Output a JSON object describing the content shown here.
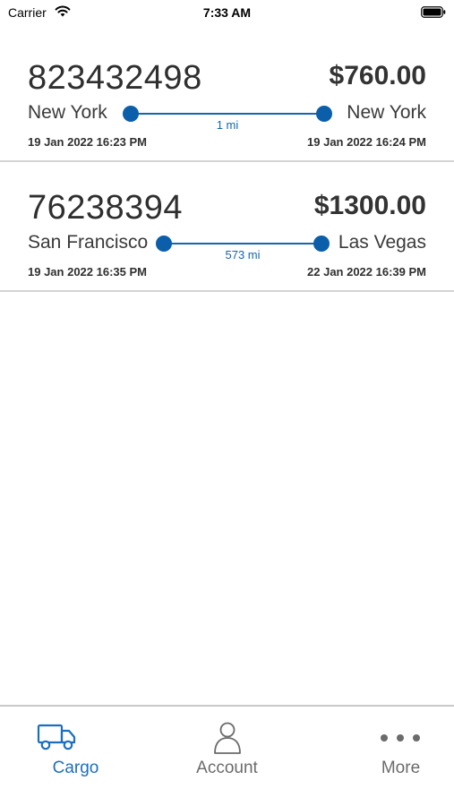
{
  "status_bar": {
    "carrier": "Carrier",
    "time": "7:33 AM"
  },
  "shipments": [
    {
      "id": "823432498",
      "price": "$760.00",
      "origin": "New York",
      "destination": "New York",
      "distance": "1 mi",
      "origin_time": "19 Jan 2022 16:23 PM",
      "destination_time": "19 Jan 2022 16:24 PM"
    },
    {
      "id": "76238394",
      "price": "$1300.00",
      "origin": "San Francisco",
      "destination": "Las Vegas",
      "distance": "573 mi",
      "origin_time": "19 Jan 2022 16:35 PM",
      "destination_time": "22 Jan 2022 16:39 PM"
    }
  ],
  "tabs": [
    {
      "label": "Cargo",
      "icon": "truck-icon",
      "active": true
    },
    {
      "label": "Account",
      "icon": "person-icon",
      "active": false
    },
    {
      "label": "More",
      "icon": "ellipsis-icon",
      "active": false
    }
  ],
  "colors": {
    "accent": "#1c6fbf",
    "route": "#0a5eaa",
    "divider": "#d4d4d4"
  }
}
